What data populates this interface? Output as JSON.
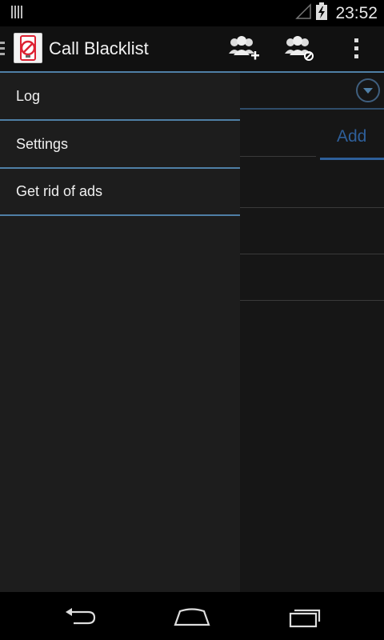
{
  "status_bar": {
    "time": "23:52",
    "icons": [
      "notification-bars-icon",
      "signal-icon",
      "battery-charging-icon"
    ]
  },
  "action_bar": {
    "title": "Call Blacklist",
    "app_icon": "blocked-phone-icon",
    "actions": [
      "add-contact-icon",
      "block-contacts-icon",
      "overflow-menu-icon"
    ]
  },
  "drawer": {
    "items": [
      {
        "label": "Log"
      },
      {
        "label": "Settings"
      },
      {
        "label": "Get rid of ads"
      }
    ]
  },
  "content": {
    "add_label": "Add"
  },
  "nav_bar": {
    "buttons": [
      "back-icon",
      "home-icon",
      "recent-apps-icon"
    ]
  },
  "colors": {
    "accent": "#4f7fa6",
    "add_blue": "#2e5f9a",
    "background": "#1b1b1b"
  }
}
